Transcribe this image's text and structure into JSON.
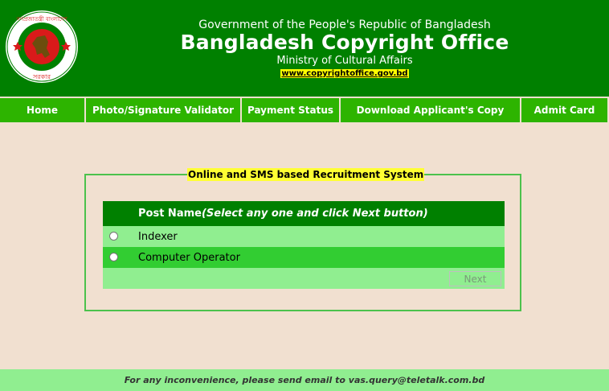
{
  "header": {
    "government_line": "Government of the People's Republic of Bangladesh",
    "title": "Bangladesh Copyright Office",
    "ministry": "Ministry of Cultural Affairs",
    "url": "www.copyrightoffice.gov.bd",
    "logo_icon": "government-seal-icon",
    "seal_text": "গণপ্রজাতন্ত্রী বাংলাদেশ সরকার"
  },
  "nav": {
    "items": [
      {
        "label": "Home"
      },
      {
        "label": "Photo/Signature Validator"
      },
      {
        "label": "Payment Status"
      },
      {
        "label": "Download Applicant's Copy"
      },
      {
        "label": "Admit Card"
      }
    ]
  },
  "form": {
    "legend": "Online and SMS based Recruitment System",
    "header_label": "Post Name",
    "header_hint": "(Select any one and click Next button)",
    "options": [
      {
        "label": "Indexer",
        "selected": false
      },
      {
        "label": "Computer Operator",
        "selected": false
      }
    ],
    "next_button": "Next"
  },
  "footer": {
    "text": "For any inconvenience, please send email to vas.query@teletalk.com.bd"
  },
  "colors": {
    "header_bg": "#008000",
    "nav_bg": "#2db400",
    "page_bg": "#f1e0d0",
    "row_light": "#90ee90",
    "row_dark": "#32cd32",
    "legend_bg": "#ffff33"
  }
}
